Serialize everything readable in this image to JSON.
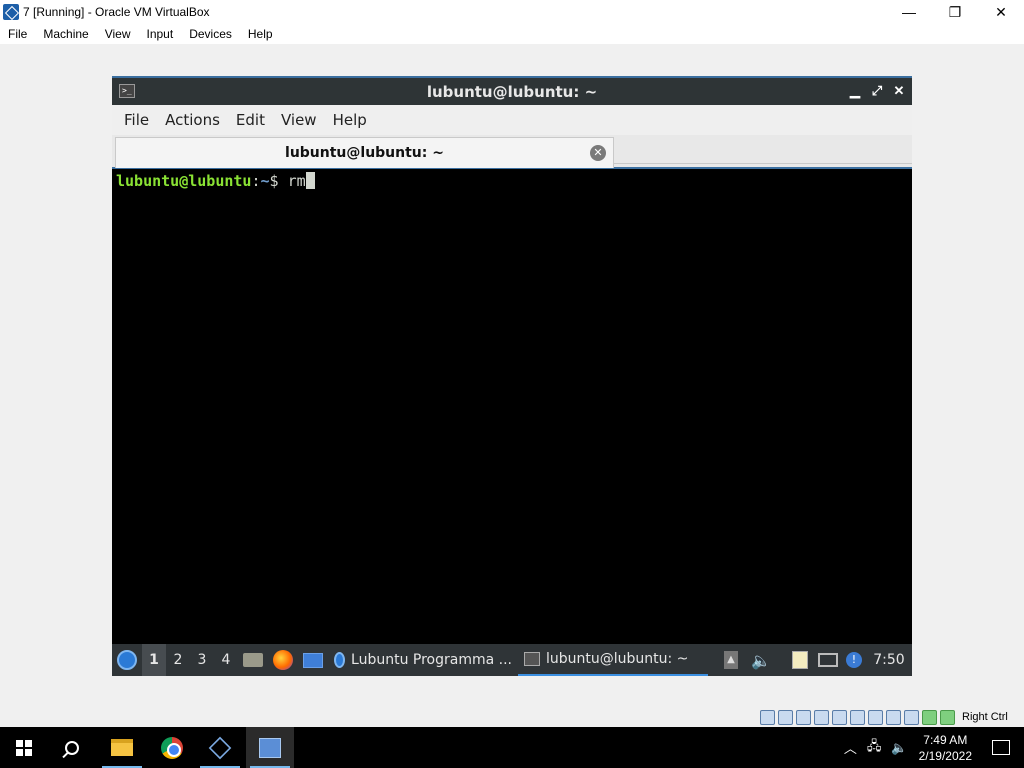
{
  "host": {
    "title": "7 [Running] - Oracle VM VirtualBox",
    "controls": {
      "minimize": "—",
      "maximize": "❐",
      "close": "✕"
    },
    "menu": [
      "File",
      "Machine",
      "View",
      "Input",
      "Devices",
      "Help"
    ]
  },
  "terminal": {
    "title": "lubuntu@lubuntu: ~",
    "controls": {
      "minimize": "▁",
      "maximize": "⤢",
      "close": "✕"
    },
    "menu": [
      "File",
      "Actions",
      "Edit",
      "View",
      "Help"
    ],
    "tab_label": "lubuntu@lubuntu: ~",
    "tab_close": "✕",
    "prompt_user": "lubuntu@lubuntu",
    "prompt_sep": ":",
    "prompt_path": "~",
    "prompt_symbol": "$ ",
    "command": "rm"
  },
  "guest_panel": {
    "workspaces": [
      "1",
      "2",
      "3",
      "4"
    ],
    "active_workspace": "1",
    "tasks": [
      {
        "label": "Lubuntu Programma ...",
        "icon": "lubuntu-icon"
      },
      {
        "label": "lubuntu@lubuntu: ~",
        "icon": "terminal-icon"
      }
    ],
    "clock": "7:50"
  },
  "vbox_status": {
    "host_key": "Right Ctrl"
  },
  "win_taskbar": {
    "clock_time": "7:49 AM",
    "clock_date": "2/19/2022"
  }
}
